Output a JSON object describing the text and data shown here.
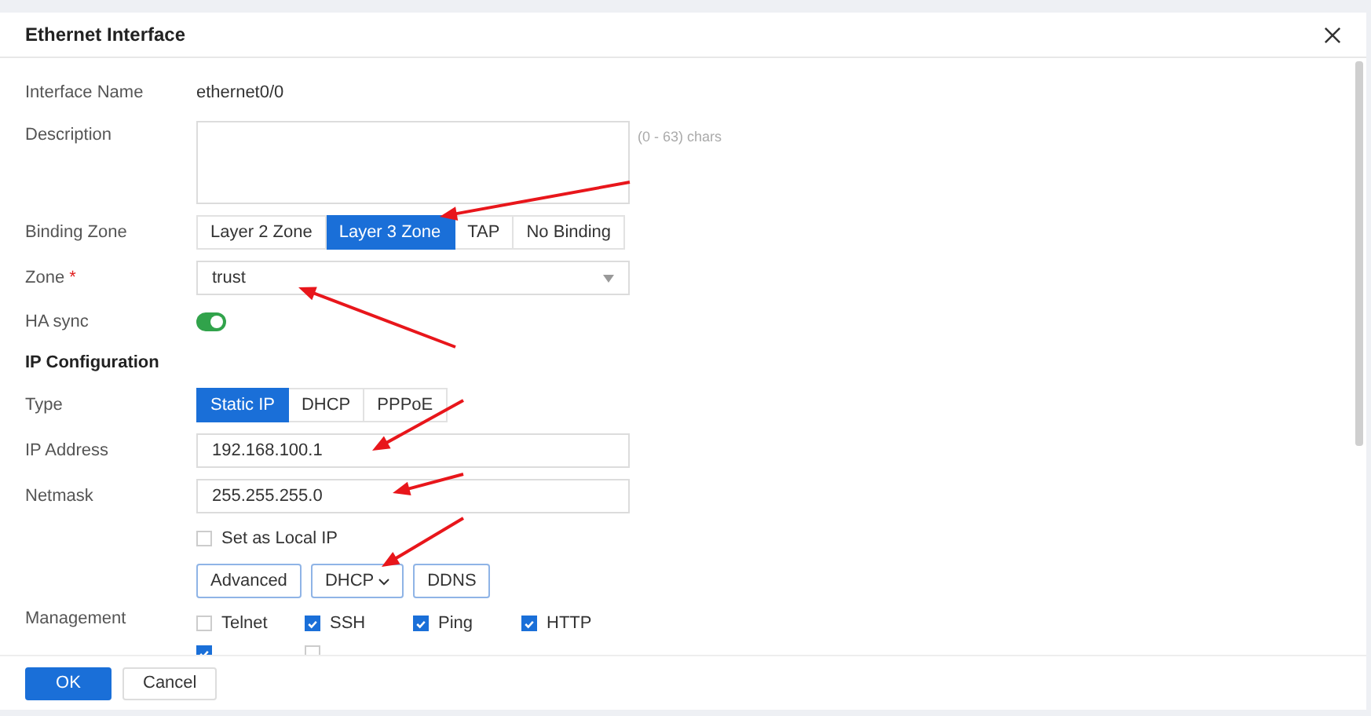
{
  "dialog": {
    "title": "Ethernet Interface"
  },
  "rows": [
    {
      "kind": "text",
      "label": "Interface Name",
      "value": "ethernet0/0"
    },
    {
      "kind": "textarea",
      "label": "Description",
      "hint": "(0 - 63) chars"
    },
    {
      "kind": "segmented",
      "label": "Binding Zone",
      "options": [
        {
          "label": "Layer 2 Zone",
          "selected": false
        },
        {
          "label": "Layer 3 Zone",
          "selected": true
        },
        {
          "label": "TAP",
          "selected": false
        },
        {
          "label": "No Binding",
          "selected": false
        }
      ]
    },
    {
      "kind": "select",
      "label": "Zone",
      "required_mark": "*",
      "value": "trust"
    },
    {
      "kind": "toggle",
      "label": "HA sync",
      "on": true
    },
    {
      "kind": "heading",
      "label": "IP Configuration"
    },
    {
      "kind": "segmented",
      "label": "Type",
      "options": [
        {
          "label": "Static IP",
          "selected": true
        },
        {
          "label": "DHCP",
          "selected": false
        },
        {
          "label": "PPPoE",
          "selected": false
        }
      ]
    },
    {
      "kind": "input",
      "label": "IP Address",
      "value": "192.168.100.1"
    },
    {
      "kind": "input",
      "label": "Netmask",
      "value": "255.255.255.0"
    },
    {
      "kind": "checkbox",
      "option": {
        "label": "Set as Local IP",
        "checked": false
      }
    },
    {
      "kind": "buttons",
      "buttons": [
        {
          "label": "Advanced",
          "dropdown": false
        },
        {
          "label": "DHCP",
          "dropdown": true
        },
        {
          "label": "DDNS",
          "dropdown": false
        }
      ]
    },
    {
      "kind": "checkgroup",
      "label": "Management",
      "options": [
        {
          "label": "Telnet",
          "checked": false
        },
        {
          "label": "SSH",
          "checked": true
        },
        {
          "label": "Ping",
          "checked": true
        },
        {
          "label": "HTTP",
          "checked": true
        },
        {
          "checked": true
        },
        {
          "checked": false
        }
      ]
    }
  ],
  "footer": {
    "buttons": [
      {
        "label": "OK",
        "primary": true
      },
      {
        "label": "Cancel",
        "primary": false
      }
    ]
  },
  "annotation_arrows": [
    {
      "kind": "arrow"
    },
    {
      "kind": "arrow"
    },
    {
      "kind": "arrow"
    },
    {
      "kind": "arrow"
    },
    {
      "kind": "arrow"
    }
  ]
}
